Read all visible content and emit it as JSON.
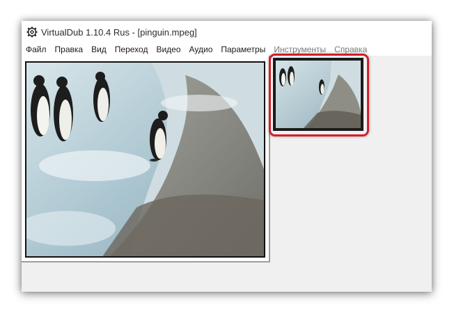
{
  "window": {
    "title": "VirtualDub 1.10.4 Rus - [pinguin.mpeg]",
    "icon": "virtualdub-app-icon"
  },
  "menu": {
    "items": [
      {
        "label": "Файл"
      },
      {
        "label": "Правка"
      },
      {
        "label": "Вид"
      },
      {
        "label": "Переход"
      },
      {
        "label": "Видео"
      },
      {
        "label": "Аудио"
      },
      {
        "label": "Параметры"
      },
      {
        "label": "Инструменты"
      },
      {
        "label": "Справка"
      }
    ]
  },
  "panes": {
    "input": {
      "content": "penguins-on-ice-video-frame"
    },
    "output": {
      "content": "penguins-on-ice-preview-frame",
      "highlighted": true,
      "highlight_color": "#d21f2a"
    }
  },
  "colors": {
    "window_bg": "#f0f0f0",
    "menu_bg": "#ffffff",
    "highlight": "#d21f2a"
  }
}
